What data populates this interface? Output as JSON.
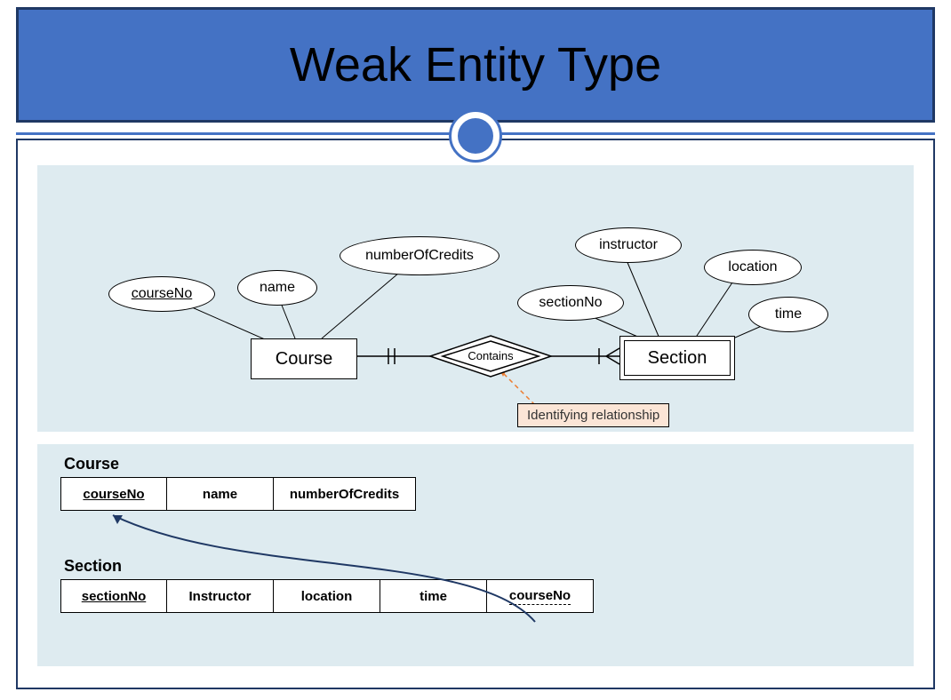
{
  "title": "Weak Entity Type",
  "er": {
    "course_entity": "Course",
    "section_entity": "Section",
    "contains_rel": "Contains",
    "attrs": {
      "courseNo": "courseNo",
      "name": "name",
      "numberOfCredits": "numberOfCredits",
      "sectionNo": "sectionNo",
      "instructor": "instructor",
      "location": "location",
      "time": "time"
    },
    "callout": "Identifying relationship"
  },
  "schema": {
    "course": {
      "title": "Course",
      "cols": [
        "courseNo",
        "name",
        "numberOfCredits"
      ]
    },
    "section": {
      "title": "Section",
      "cols": [
        "sectionNo",
        "Instructor",
        "location",
        "time",
        "courseNo"
      ]
    }
  }
}
